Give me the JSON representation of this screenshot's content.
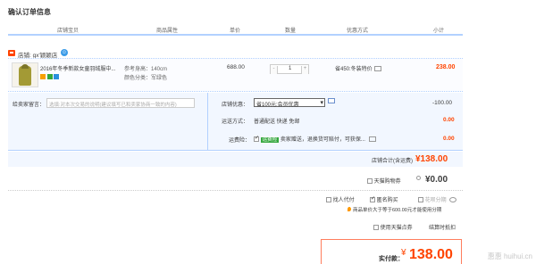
{
  "page": {
    "title": "确认订单信息"
  },
  "table_header": {
    "columns": [
      "店铺宝贝",
      "商品属性",
      "单价",
      "数量",
      "优惠方式",
      "小计"
    ]
  },
  "shop": {
    "label": "店铺:",
    "name": "gx'颖颖店"
  },
  "item": {
    "name": "2016年冬季新款女童羽绒服中...",
    "attr_size": "参考身高：140cm",
    "attr_color": "颜色分类：军绿色",
    "price": "688.00",
    "qty_minus": "-",
    "quantity": "1",
    "qty_plus": "+",
    "promotion": "省450:冬装特价",
    "subtotal": "238.00"
  },
  "message": {
    "label": "给卖家留言：",
    "placeholder": "选填:对本次交易的说明(建议填写已和卖家协商一致的内容)"
  },
  "shop_discount": {
    "label": "店铺优惠：",
    "selected": "省100元:会员优惠",
    "amount": "-100.00"
  },
  "delivery": {
    "label": "运送方式：",
    "value": "普通配送 快递 免邮",
    "amount": "0.00"
  },
  "insurance": {
    "label": "运费险：",
    "badge": "运费险",
    "text": "卖家赠送，退换货可赔付，可获保...",
    "amount": "0.00"
  },
  "shop_total": {
    "label": "店铺合计(含运费)",
    "amount": "¥138.00"
  },
  "tmall_points": {
    "label": "天猫购物券",
    "amount": "¥0.00"
  },
  "options": {
    "anonymous": "匿名购买",
    "agent": "找人代付",
    "installment": "花呗分期",
    "installment_note": "商品单价大于等于600.00元才能使用分期"
  },
  "tmall_points_use": {
    "label": "使用天猫点券",
    "link": "结算时抵扣"
  },
  "payment": {
    "label": "实付款：",
    "currency": "¥",
    "amount": "138.00"
  },
  "watermark": "惠惠 huihui.cn",
  "colors": {
    "accent": "#ff4400",
    "header_border": "#b2d1ff",
    "panel_bg": "#f2f7ff",
    "green": "#35a73e"
  }
}
